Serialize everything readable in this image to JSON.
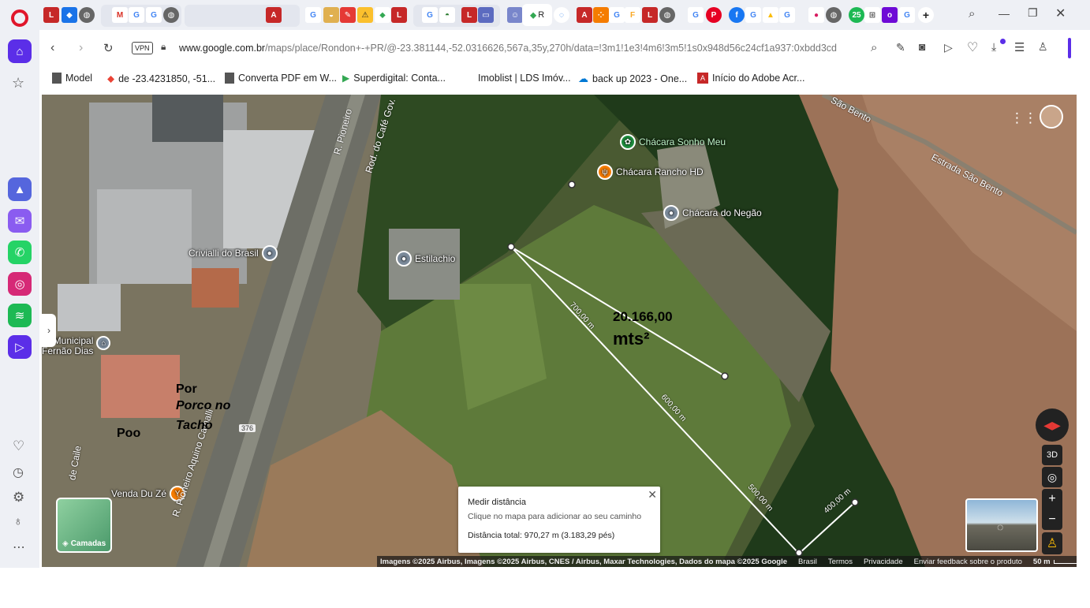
{
  "browser": {
    "url_host": "www.google.com.br",
    "url_path": "/maps/place/Rondon+-+PR/@-23.381144,-52.0316626,567a,35y,270h/data=!3m1!1e3!4m6!3m5!1s0x948d56c24cf1a937:0xbdd3cd",
    "vpn_label": "VPN",
    "active_tab_label": "R"
  },
  "bookmarks": [
    {
      "label": "Model",
      "icon": "folder-icon"
    },
    {
      "label": "de -23.4231850, -51...",
      "icon": "maps-pin-icon"
    },
    {
      "label": "Converta PDF em W...",
      "icon": "folder-icon"
    },
    {
      "label": "Superdigital: Conta...",
      "icon": "play-store-icon"
    },
    {
      "label": "Imoblist | LDS Imóv...",
      "icon": ""
    },
    {
      "label": "back up 2023 - One...",
      "icon": "onedrive-icon"
    },
    {
      "label": "Início do Adobe Acr...",
      "icon": "adobe-icon"
    }
  ],
  "map": {
    "pois": [
      {
        "label": "Chácara Sonho Meu",
        "icon": "park-icon",
        "color": "#1e8e3e"
      },
      {
        "label": "Chácara Rancho HD",
        "icon": "restaurant-icon",
        "color": "#f57c00"
      },
      {
        "label": "Chácara do Negão",
        "icon": "place-icon",
        "color": "#7b8a9a"
      },
      {
        "label": "Estilachio",
        "icon": "place-icon",
        "color": "#7b8a9a"
      },
      {
        "label": "Crivialli do Brasil",
        "icon": "place-icon",
        "color": "#7b8a9a"
      },
      {
        "label": "Venda Du Zé",
        "icon": "bar-icon",
        "color": "#f57c00"
      }
    ],
    "school_label": "Municipal\nFernão Dias",
    "roads": [
      "R. Pioneiro",
      "Rod. do Café Gov.",
      "Estrada São Bento",
      "São Bento",
      "R. Pioneiro Aquino Camalli",
      "376",
      "de Caile"
    ],
    "annotation_area": "20.166,00",
    "annotation_unit": "mts²",
    "annotation_por": "Por",
    "annotation_porco": "Porco no",
    "annotation_tacho": "Tacho",
    "annotation_poo": "Poo",
    "distance_labels": [
      "700,00 m",
      "600,00 m",
      "500,00 m",
      "400,00 m"
    ],
    "layers_label": "Camadas",
    "controls": {
      "three_d": "3D",
      "zoom_in": "+",
      "zoom_out": "−"
    }
  },
  "measure": {
    "title": "Medir distância",
    "hint": "Clique no mapa para adicionar ao seu caminho",
    "total": "Distância total: 970,27 m (3.183,29 pés)"
  },
  "footer": {
    "imagery": "Imagens ©2025 Airbus, Imagens ©2025 Airbus, CNES / Airbus, Maxar Technologies, Dados do mapa ©2025 Google",
    "country": "Brasil",
    "terms": "Termos",
    "privacy": "Privacidade",
    "feedback": "Enviar feedback sobre o produto",
    "scale": "50 m"
  }
}
